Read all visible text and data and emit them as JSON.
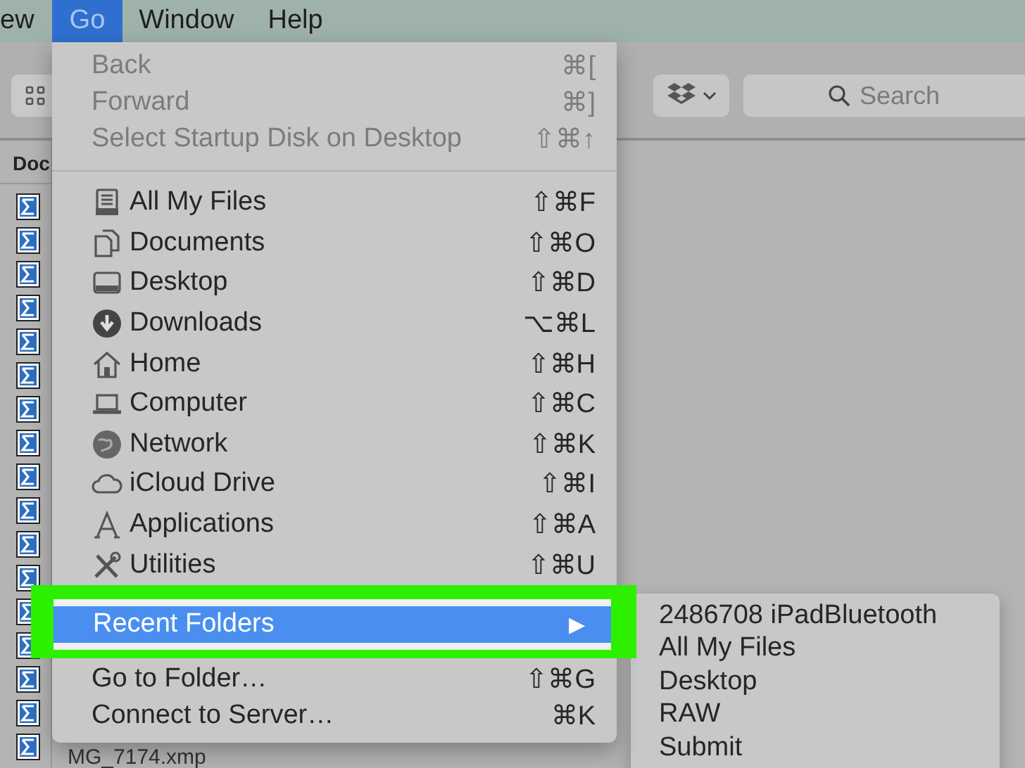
{
  "menu_bar": {
    "items": [
      {
        "label": "ew",
        "selected": false
      },
      {
        "label": "Go",
        "selected": true
      },
      {
        "label": "Window",
        "selected": false
      },
      {
        "label": "Help",
        "selected": false
      }
    ]
  },
  "toolbar": {
    "search": {
      "placeholder": "Search"
    }
  },
  "file_list": {
    "column_header": "Doc",
    "file_name": "MG_7174.xmp"
  },
  "go_menu": {
    "items": [
      {
        "kind": "plain",
        "label": "Back",
        "shortcut": "⌘[",
        "disabled": true,
        "selected": false
      },
      {
        "kind": "plain",
        "label": "Forward",
        "shortcut": "⌘]",
        "disabled": true,
        "selected": false
      },
      {
        "kind": "plain",
        "label": "Select Startup Disk on Desktop",
        "shortcut": "⇧⌘↑",
        "disabled": true,
        "selected": false
      },
      {
        "kind": "separator"
      },
      {
        "kind": "place",
        "label": "All My Files",
        "shortcut": "⇧⌘F",
        "disabled": false,
        "selected": false
      },
      {
        "kind": "place",
        "label": "Documents",
        "shortcut": "⇧⌘O",
        "disabled": false,
        "selected": false
      },
      {
        "kind": "place",
        "label": "Desktop",
        "shortcut": "⇧⌘D",
        "disabled": false,
        "selected": false
      },
      {
        "kind": "place",
        "label": "Downloads",
        "shortcut": "⌥⌘L",
        "disabled": false,
        "selected": false
      },
      {
        "kind": "place",
        "label": "Home",
        "shortcut": "⇧⌘H",
        "disabled": false,
        "selected": false
      },
      {
        "kind": "place",
        "label": "Computer",
        "shortcut": "⇧⌘C",
        "disabled": false,
        "selected": false
      },
      {
        "kind": "place",
        "label": "Network",
        "shortcut": "⇧⌘K",
        "disabled": false,
        "selected": false
      },
      {
        "kind": "place",
        "label": "iCloud Drive",
        "shortcut": "⇧⌘I",
        "disabled": false,
        "selected": false
      },
      {
        "kind": "place",
        "label": "Applications",
        "shortcut": "⇧⌘A",
        "disabled": false,
        "selected": false
      },
      {
        "kind": "place",
        "label": "Utilities",
        "shortcut": "⇧⌘U",
        "disabled": false,
        "selected": false
      },
      {
        "kind": "submenu",
        "label": "Recent Folders",
        "arrow": "▶",
        "disabled": false,
        "selected": true,
        "callout": true
      },
      {
        "kind": "plain",
        "label": "Go to Folder…",
        "shortcut": "⇧⌘G",
        "disabled": false,
        "selected": false
      },
      {
        "kind": "plain",
        "label": "Connect to Server…",
        "shortcut": "⌘K",
        "disabled": false,
        "selected": false
      }
    ]
  },
  "recent_folders_submenu": {
    "items": [
      {
        "label": "2486708 iPadBluetooth"
      },
      {
        "label": "All My Files"
      },
      {
        "label": "Desktop"
      },
      {
        "label": "RAW"
      },
      {
        "label": "Submit"
      }
    ]
  }
}
